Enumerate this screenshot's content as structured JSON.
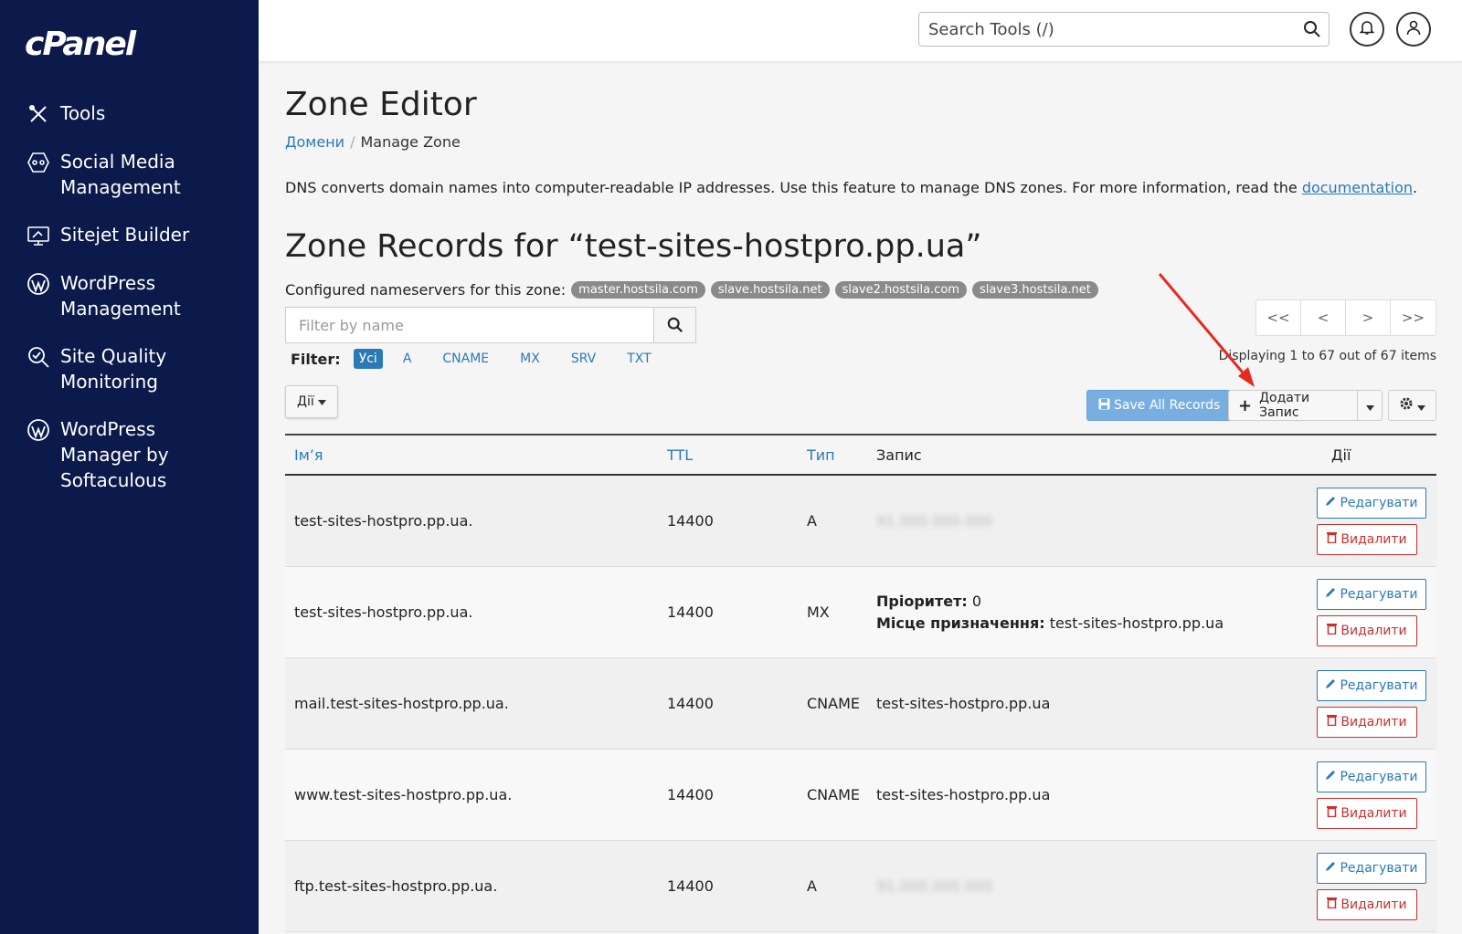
{
  "app": {
    "logo": "cPanel"
  },
  "sidebar": {
    "items": [
      {
        "label": "Tools",
        "icon": "tools-icon"
      },
      {
        "label": "Social Media Management",
        "icon": "social-media-icon"
      },
      {
        "label": "Sitejet Builder",
        "icon": "sitejet-icon"
      },
      {
        "label": "WordPress Management",
        "icon": "wordpress-icon"
      },
      {
        "label": "Site Quality Monitoring",
        "icon": "site-quality-icon"
      },
      {
        "label": "WordPress Manager by Softaculous",
        "icon": "wordpress-icon"
      }
    ]
  },
  "topbar": {
    "search_placeholder": "Search Tools (/)"
  },
  "page": {
    "title": "Zone Editor",
    "breadcrumb": {
      "parent": "Домени",
      "current": "Manage Zone"
    },
    "description": "DNS converts domain names into computer-readable IP addresses. Use this feature to manage DNS zones. For more information, read the ",
    "description_link": "documentation",
    "zone_title": "Zone Records for “test-sites-hostpro.pp.ua”",
    "nameservers_label": "Configured nameservers for this zone:",
    "nameservers": [
      "master.hostsila.com",
      "slave.hostsila.net",
      "slave2.hostsila.com",
      "slave3.hostsila.net"
    ]
  },
  "filter": {
    "placeholder": "Filter by name",
    "label": "Filter:",
    "tabs": [
      "Усі",
      "A",
      "CNAME",
      "MX",
      "SRV",
      "TXT"
    ],
    "active": "Усі"
  },
  "pager": {
    "first": "<<",
    "prev": "<",
    "next": ">",
    "last": ">>",
    "displaying": "Displaying 1 to 67 out of 67 items"
  },
  "toolbar": {
    "actions": "Дії",
    "save_all": "Save All Records",
    "add_record": "Додати Запис"
  },
  "table": {
    "headers": {
      "name": "Ім’я",
      "ttl": "TTL",
      "type": "Тип",
      "record": "Запис",
      "actions": "Дії"
    },
    "edit_label": "Редагувати",
    "delete_label": "Видалити",
    "priority_label": "Пріоритет:",
    "destination_label": "Місце призначення:",
    "rows": [
      {
        "name": "test-sites-hostpro.pp.ua.",
        "ttl": "14400",
        "type": "A",
        "record": "91.000.000.000"
      },
      {
        "name": "test-sites-hostpro.pp.ua.",
        "ttl": "14400",
        "type": "MX",
        "priority": "0",
        "destination": "test-sites-hostpro.pp.ua"
      },
      {
        "name": "mail.test-sites-hostpro.pp.ua.",
        "ttl": "14400",
        "type": "CNAME",
        "record": "test-sites-hostpro.pp.ua"
      },
      {
        "name": "www.test-sites-hostpro.pp.ua.",
        "ttl": "14400",
        "type": "CNAME",
        "record": "test-sites-hostpro.pp.ua"
      },
      {
        "name": "ftp.test-sites-hostpro.pp.ua.",
        "ttl": "14400",
        "type": "A",
        "record": "91.000.000.000"
      }
    ]
  },
  "colors": {
    "sidebar_bg": "#0b1a4a",
    "link": "#2a7ab8",
    "danger": "#c9302c",
    "annotation_arrow": "#e8281e"
  }
}
